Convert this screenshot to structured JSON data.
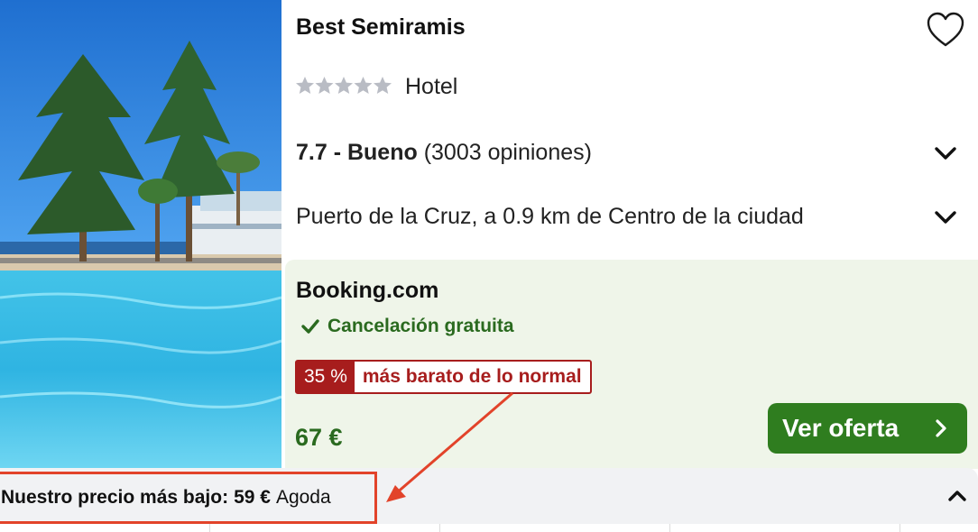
{
  "hotel": {
    "name": "Best Semiramis",
    "type": "Hotel",
    "stars_filled": 0,
    "stars_total": 5,
    "rating_score": "7.7 - Bueno",
    "rating_count": "(3003 opiniones)",
    "location": "Puerto de la Cruz, a 0.9 km de Centro de la ciudad"
  },
  "offer": {
    "provider": "Booking.com",
    "cancellation": "Cancelación gratuita",
    "discount_pct": "35 %",
    "discount_text": "más barato de lo normal",
    "price": "67 €",
    "cta_label": "Ver oferta"
  },
  "lowest_price": {
    "label": "Nuestro precio más bajo:",
    "price": "59 €",
    "provider": "Agoda"
  },
  "icons": {
    "favorite": "heart-outline-icon",
    "expand": "chevron-down-icon",
    "collapse": "chevron-up-icon",
    "cta_arrow": "chevron-right-icon",
    "check": "check-icon"
  },
  "colors": {
    "green_text": "#2a6a1f",
    "cta_green": "#2f7d1f",
    "deal_red": "#a71d1d",
    "annotation_red": "#e2432a",
    "offer_bg": "#eff5e9"
  }
}
